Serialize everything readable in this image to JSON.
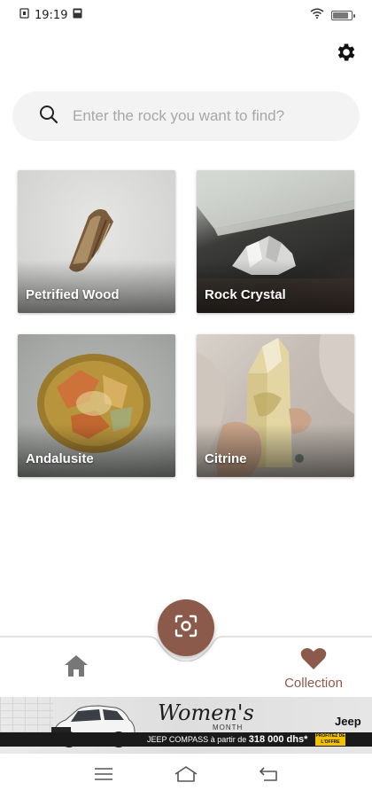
{
  "status_bar": {
    "time": "19:19",
    "battery": "99"
  },
  "search": {
    "placeholder": "Enter the rock you want to find?",
    "value": ""
  },
  "rocks": [
    {
      "name": "Petrified Wood"
    },
    {
      "name": "Rock Crystal"
    },
    {
      "name": "Andalusite"
    },
    {
      "name": "Citrine"
    }
  ],
  "bottom_nav": {
    "collection_label": "Collection"
  },
  "ad": {
    "headline": "Women's",
    "sub": "MONTH",
    "offer_text": "JEEP COMPASS à partir de",
    "offer_price": "318 000 dhs*",
    "cta": "PROFITEZ DE L'OFFRE",
    "brand": "Jeep"
  },
  "colors": {
    "accent": "#8c5a4a",
    "search_bg": "#f3f3f3"
  }
}
